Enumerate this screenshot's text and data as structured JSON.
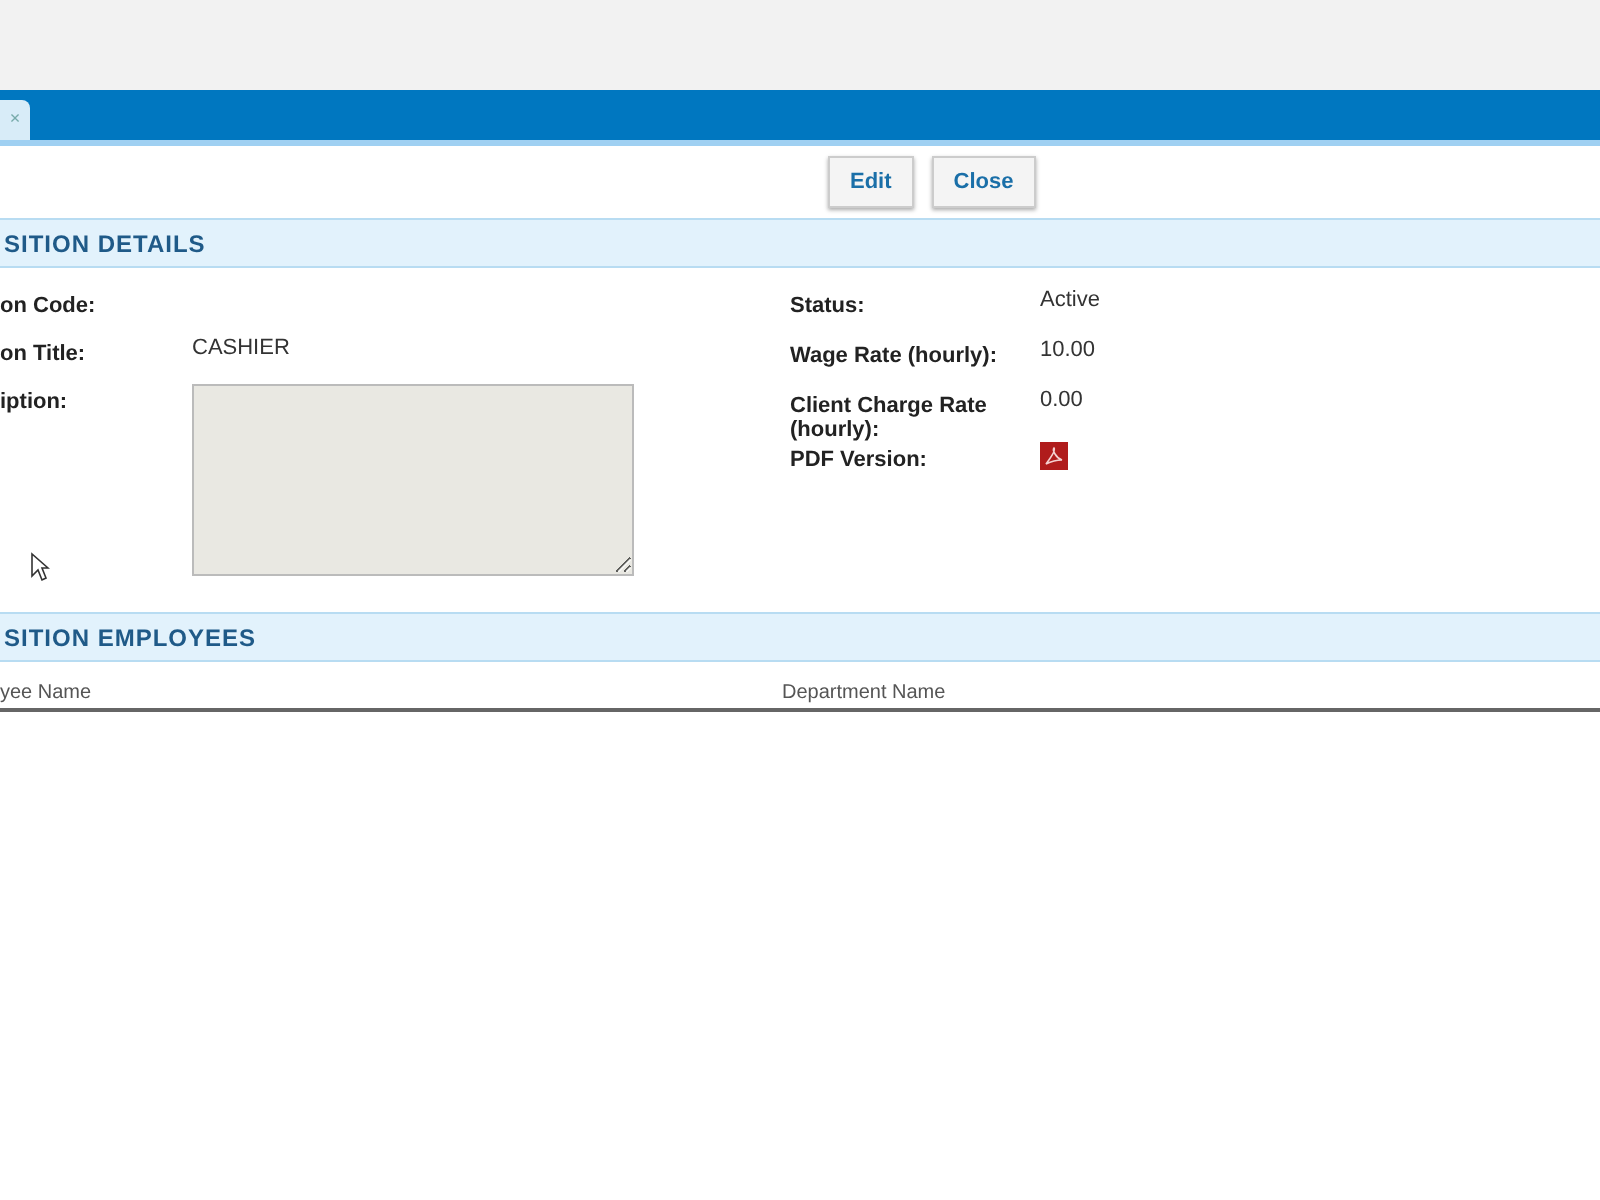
{
  "tab": {
    "close": "×"
  },
  "buttons": [
    "Edit",
    "Close"
  ],
  "details": {
    "title": "SITION DETAILS",
    "left": [
      {
        "label": "on Code:"
      },
      {
        "label": "on Title:",
        "value": "CASHIER"
      },
      {
        "label": "iption:",
        "kind": "textarea"
      }
    ],
    "right": [
      {
        "label": "Status:",
        "value": "Active"
      },
      {
        "label": "Wage Rate (hourly):",
        "value": "10.00"
      },
      {
        "label": "Client Charge Rate (hourly):",
        "value": "0.00"
      },
      {
        "label": "PDF Version:",
        "kind": "pdf"
      }
    ]
  },
  "employees": {
    "title": "SITION EMPLOYEES",
    "columns": [
      "yee Name",
      "Department Name"
    ]
  }
}
